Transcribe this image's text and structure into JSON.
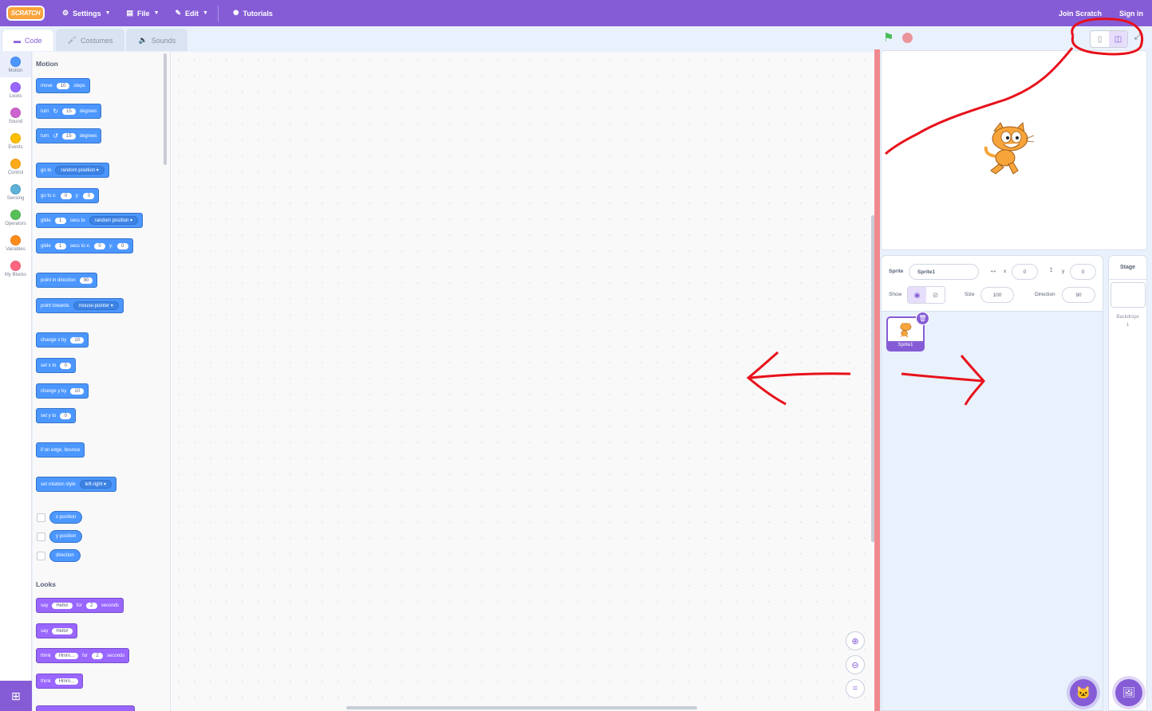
{
  "menubar": {
    "logo": "SCRATCH",
    "settings": "Settings",
    "file": "File",
    "edit": "Edit",
    "tutorials": "Tutorials",
    "join": "Join Scratch",
    "signin": "Sign in"
  },
  "tabs": {
    "code": "Code",
    "costumes": "Costumes",
    "sounds": "Sounds"
  },
  "categories": [
    {
      "label": "Motion",
      "color": "#4c97ff"
    },
    {
      "label": "Looks",
      "color": "#9966ff"
    },
    {
      "label": "Sound",
      "color": "#cf63cf"
    },
    {
      "label": "Events",
      "color": "#ffbf00"
    },
    {
      "label": "Control",
      "color": "#ffab19"
    },
    {
      "label": "Sensing",
      "color": "#5cb1d6"
    },
    {
      "label": "Operators",
      "color": "#59c059"
    },
    {
      "label": "Variables",
      "color": "#ff8c1a"
    },
    {
      "label": "My Blocks",
      "color": "#ff6680"
    }
  ],
  "palette": {
    "motion_title": "Motion",
    "looks_title": "Looks",
    "move": {
      "a": "move",
      "v": "10",
      "b": "steps"
    },
    "turn_cw": {
      "a": "turn",
      "v": "15",
      "b": "degrees"
    },
    "turn_ccw": {
      "a": "turn",
      "v": "15",
      "b": "degrees"
    },
    "goto": {
      "a": "go to",
      "dd": "random position ▾"
    },
    "gotoxy": {
      "a": "go to x:",
      "x": "0",
      "b": "y:",
      "y": "0"
    },
    "glide_to": {
      "a": "glide",
      "v": "1",
      "b": "secs to",
      "dd": "random position ▾"
    },
    "glide_xy": {
      "a": "glide",
      "v": "1",
      "b": "secs to x:",
      "x": "0",
      "c": "y:",
      "y": "0"
    },
    "point_dir": {
      "a": "point in direction",
      "v": "90"
    },
    "point_towards": {
      "a": "point towards",
      "dd": "mouse-pointer ▾"
    },
    "change_x": {
      "a": "change x by",
      "v": "10"
    },
    "set_x": {
      "a": "set x to",
      "v": "0"
    },
    "change_y": {
      "a": "change y by",
      "v": "10"
    },
    "set_y": {
      "a": "set y to",
      "v": "0"
    },
    "bounce": "if on edge, bounce",
    "rotation": {
      "a": "set rotation style",
      "dd": "left-right ▾"
    },
    "rep_x": "x position",
    "rep_y": "y position",
    "rep_dir": "direction",
    "say_for": {
      "a": "say",
      "v": "Hello!",
      "b": "for",
      "n": "2",
      "c": "seconds"
    },
    "say": {
      "a": "say",
      "v": "Hello!"
    },
    "think_for": {
      "a": "think",
      "v": "Hmm...",
      "b": "for",
      "n": "2",
      "c": "seconds"
    },
    "think": {
      "a": "think",
      "v": "Hmm..."
    }
  },
  "sprite_info": {
    "sprite_label": "Sprite",
    "sprite_name": "Sprite1",
    "x_label": "x",
    "x": "0",
    "y_label": "y",
    "y": "0",
    "show_label": "Show",
    "size_label": "Size",
    "size": "100",
    "direction_label": "Direction",
    "direction": "90"
  },
  "sprite_tile": {
    "name": "Sprite1"
  },
  "stage_pane": {
    "title": "Stage",
    "backdrops_label": "Backdrops",
    "backdrops_count": "1"
  },
  "annotation_color": "#e8101a"
}
